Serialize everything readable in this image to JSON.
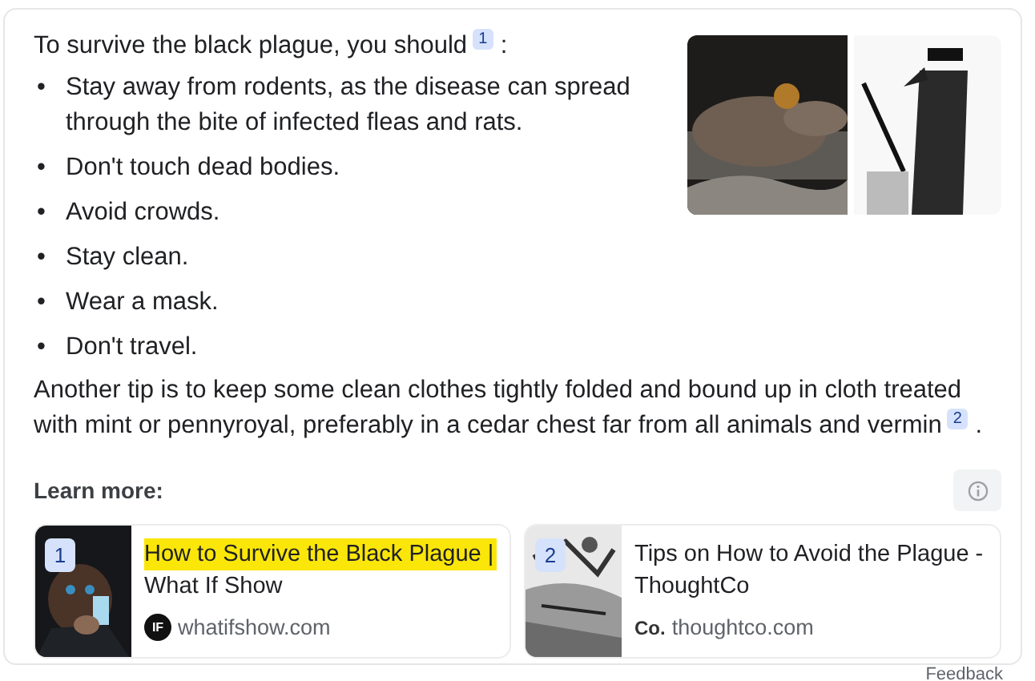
{
  "answer": {
    "intro": "To survive the black plague, you should",
    "intro_citation": "1",
    "intro_end": ":",
    "marker": "•",
    "bullets": [
      "Stay away from rodents, as the disease can spread through the bite of infected fleas and rats.",
      "Don't touch dead bodies.",
      "Avoid crowds.",
      "Stay clean.",
      "Wear a mask.",
      "Don't travel."
    ],
    "tip": "Another tip is to keep some clean clothes tightly folded and bound up in cloth treated with mint or pennyroyal, preferably in a cedar chest far from all animals and vermin",
    "tip_citation": "2",
    "tip_end": "."
  },
  "learn_more": {
    "heading": "Learn more:",
    "sources": [
      {
        "number": "1",
        "title": "How to Survive the Black Plague | What If Show",
        "highlighted": true,
        "logo_text": "IF",
        "site": "whatifshow.com",
        "kind": "dark"
      },
      {
        "number": "2",
        "title": "Tips on How to Avoid the Plague - ThoughtCo",
        "highlighted": false,
        "logo_text": "Co.",
        "site": "thoughtco.com",
        "kind": "engraving"
      }
    ]
  },
  "footer": {
    "feedback": "Feedback"
  }
}
